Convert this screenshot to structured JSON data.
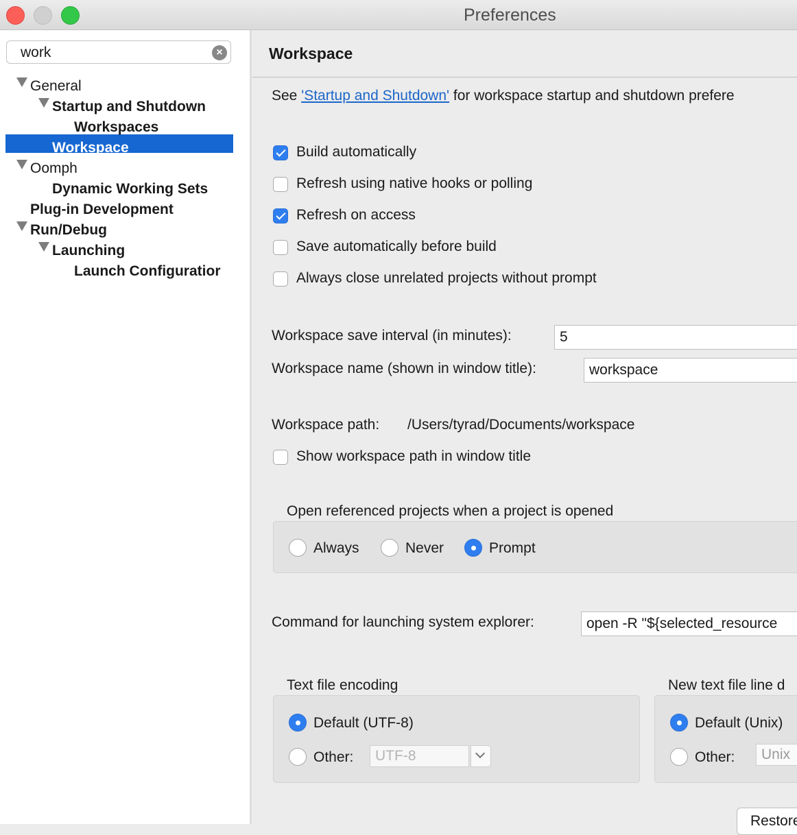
{
  "window": {
    "title": "Preferences"
  },
  "search": {
    "value": "work",
    "clear_icon": "clear-circle-icon"
  },
  "tree": {
    "general": "General",
    "startup_shutdown": "Startup and Shutdown",
    "workspaces": "Workspaces",
    "workspace": "Workspace",
    "oomph": "Oomph",
    "dynamic_working_sets": "Dynamic Working Sets",
    "plugin_development": "Plug-in Development",
    "run_debug": "Run/Debug",
    "launching": "Launching",
    "launch_configurations": "Launch Configuratior"
  },
  "page": {
    "title": "Workspace",
    "intro_prefix": "See ",
    "intro_link": "'Startup and Shutdown'",
    "intro_suffix": " for workspace startup and shutdown prefere",
    "checkboxes": {
      "build_automatically": {
        "label": "Build automatically",
        "checked": true
      },
      "refresh_native": {
        "label": "Refresh using native hooks or polling",
        "checked": false
      },
      "refresh_on_access": {
        "label": "Refresh on access",
        "checked": true
      },
      "save_before_build": {
        "label": "Save automatically before build",
        "checked": false
      },
      "close_unrelated": {
        "label": "Always close unrelated projects without prompt",
        "checked": false
      }
    },
    "save_interval_label": "Workspace save interval (in minutes):",
    "save_interval_value": "5",
    "name_label": "Workspace name (shown in window title):",
    "name_value": "workspace",
    "path_label": "Workspace path:",
    "path_value": "/Users/tyrad/Documents/workspace",
    "show_path_label": "Show workspace path in window title",
    "open_referenced": {
      "label": "Open referenced projects when a project is opened",
      "options": [
        "Always",
        "Never",
        "Prompt"
      ],
      "selected": "Prompt"
    },
    "explorer_label": "Command for launching system explorer:",
    "explorer_value": "open -R \"${selected_resource",
    "encoding": {
      "label": "Text file encoding",
      "default": "Default (UTF-8)",
      "other": "Other:",
      "other_value": "UTF-8",
      "selected": "default"
    },
    "line_delimiter": {
      "label": "New text file line d",
      "default": "Default (Unix)",
      "other": "Other:",
      "other_value": "Unix",
      "selected": "default"
    },
    "restore_button": "Restore Defaults"
  },
  "colors": {
    "accent": "#2f7ef0",
    "selection": "#1667d1",
    "link": "#1b66c9"
  }
}
